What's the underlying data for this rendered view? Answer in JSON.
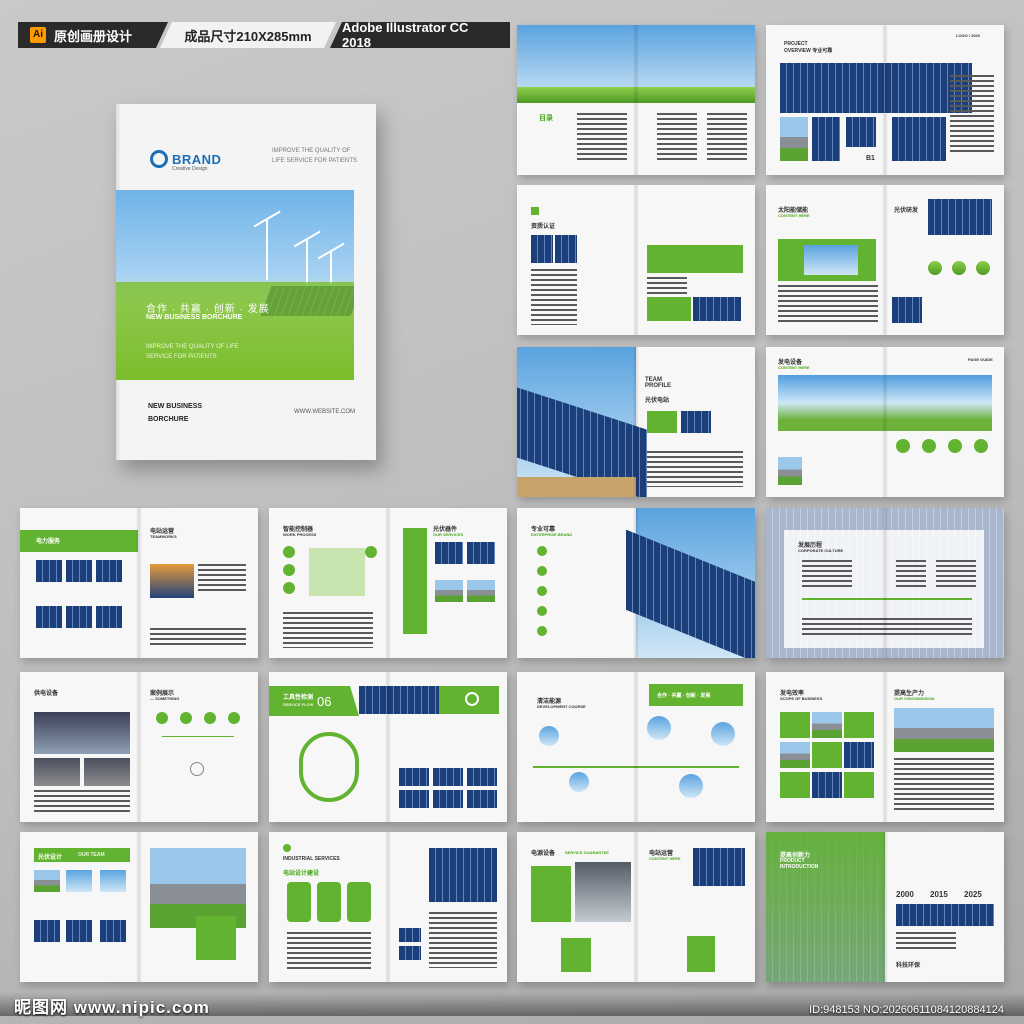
{
  "header": {
    "software_badge": "Ai",
    "tag1": "原创画册设计",
    "tag2": "成品尺寸210X285mm",
    "tag3": "Adobe Illustrator CC 2018"
  },
  "cover": {
    "brand": "BRAND",
    "brand_sub": "Creative Design",
    "slogan": "IMPROVE THE QUALITY OF LIFE SERVICE FOR PATIENTS",
    "cn_title": "合作 · 共赢 · 创新 · 发展",
    "en_title": "NEW BUSINESS BORCHURE",
    "sub": "IMPROVE THE QUALITY OF LIFE SERVICE FOR PATIENTS",
    "bottom_title": "NEW BUSINESS BORCHURE",
    "website": "WWW.WEBSITE.COM"
  },
  "spreads": {
    "s1": {
      "title": "目录"
    },
    "s2": {
      "title": "PROJECT OVERVIEW 专业可靠",
      "logo": "LOGO / 2020",
      "label": "B1"
    },
    "s3": {
      "title": "资质认证"
    },
    "s4": {
      "title": "太阳能储能",
      "sub": "CONTENT HERE",
      "title2": "光伏研发"
    },
    "s5": {
      "title": "TEAM PROFILE",
      "sub": "光伏电站"
    },
    "s6": {
      "title": "发电设备",
      "sub": "CONTENT HERE",
      "pg": "PAGE GUIDE"
    },
    "s7": {
      "title": "电力服务",
      "title2": "电站运营",
      "sub2": "TEAMWORKS"
    },
    "s8": {
      "title": "智能控制器",
      "sub": "WORK PROCESS",
      "title2": "光伏器件",
      "sub2": "OUR SERVICES"
    },
    "s9": {
      "title": "专业可靠",
      "sub": "ENTERPRISE BRAND"
    },
    "s10": {
      "title": "发展历程",
      "sub": "CORPORATE CULTURE"
    },
    "s11": {
      "title": "供电设备",
      "title2": "案例展示",
      "sub2": "— SOMETHING"
    },
    "s12": {
      "title": "工具性检测",
      "sub": "SERVICE FLOW",
      "num": "06"
    },
    "s13": {
      "title": "清洁能源",
      "sub": "DEVELOPMENT COURSE",
      "banner": "合作 · 共赢 · 创新 · 发展"
    },
    "s14": {
      "title": "发电效率",
      "sub": "SCOPE OF BUSINESS",
      "title2": "提高生产力",
      "sub2": "OUR VISIONMISSION"
    },
    "s15": {
      "title": "光伏设计",
      "sub": "OUR TEAM"
    },
    "s16": {
      "title": "INDUSTRIAL SERVICES",
      "sub": "电站设计建设"
    },
    "s17": {
      "title": "电源设备",
      "sub": "SERVICE GUARANTEE",
      "title2": "电站运营",
      "sub2": "CONTENT HERE"
    },
    "s18": {
      "title": "提高创新力",
      "sub": "PRODUCT INTRODUCTION",
      "years": [
        "2000",
        "2015",
        "2025"
      ],
      "footer": "科技环保"
    }
  },
  "watermark": {
    "site": "昵图网 www.nipic.com",
    "id": "ID:948153 NO:20260611084120884124"
  },
  "colors": {
    "accent": "#62b32f",
    "dark": "#2a2a2a",
    "blue": "#1a6fb8"
  }
}
